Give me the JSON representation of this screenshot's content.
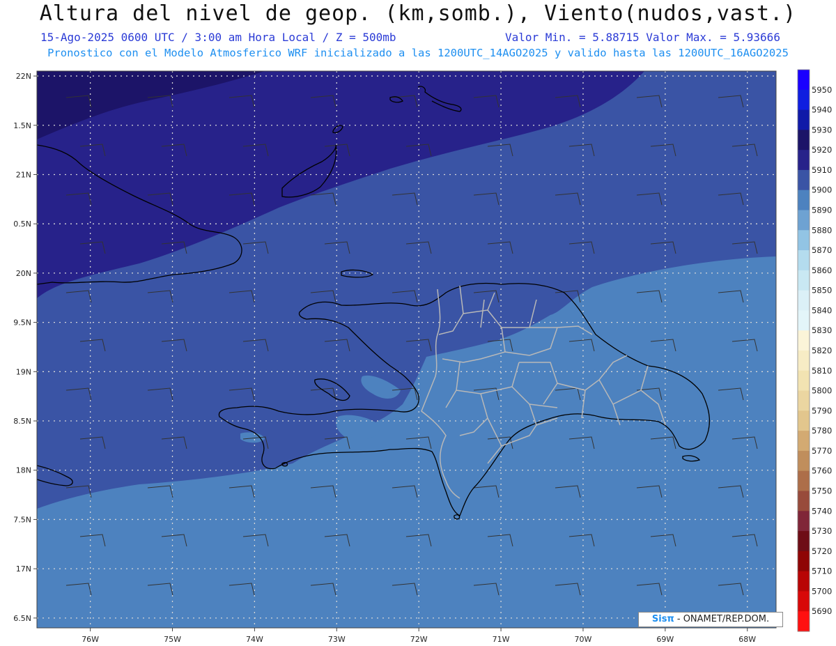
{
  "header": {
    "title": "Altura del nivel de geop. (km,somb.), Viento(nudos,vast.)",
    "line1": "15-Ago-2025  0600 UTC / 3:00 am Hora Local / Z = 500mb",
    "minmax": "Valor Min. = 5.88715  Valor Max. = 5.93666",
    "line2": "Pronostico con el Modelo Atmosferico WRF inicializado a las 1200UTC_14AGO2025 y valido hasta las  1200UTC_16AGO2025"
  },
  "credit": {
    "logo": "Sisπ",
    "text": "- ONAMET/REP.DOM."
  },
  "map": {
    "lon_range": [
      -76.65,
      -67.65
    ],
    "lat_range": [
      16.4,
      22.05
    ],
    "lon_ticks": [
      {
        "value": -76,
        "label": "76W"
      },
      {
        "value": -75,
        "label": "75W"
      },
      {
        "value": -74,
        "label": "74W"
      },
      {
        "value": -73,
        "label": "73W"
      },
      {
        "value": -72,
        "label": "72W"
      },
      {
        "value": -71,
        "label": "71W"
      },
      {
        "value": -70,
        "label": "70W"
      },
      {
        "value": -69,
        "label": "69W"
      },
      {
        "value": -68,
        "label": "68W"
      }
    ],
    "lat_ticks": [
      {
        "value": 22,
        "label": "22N"
      },
      {
        "value": 21.5,
        "label": "1.5N"
      },
      {
        "value": 21,
        "label": "21N"
      },
      {
        "value": 20.5,
        "label": "0.5N"
      },
      {
        "value": 20,
        "label": "20N"
      },
      {
        "value": 19.5,
        "label": "9.5N"
      },
      {
        "value": 19,
        "label": "19N"
      },
      {
        "value": 18.5,
        "label": "8.5N"
      },
      {
        "value": 18,
        "label": "18N"
      },
      {
        "value": 17.5,
        "label": "7.5N"
      },
      {
        "value": 17,
        "label": "17N"
      },
      {
        "value": 16.5,
        "label": "6.5N"
      }
    ],
    "band_colors": {
      "b5920": "#1c1468",
      "b5910": "#27228a",
      "b5900": "#3a54a5",
      "b5890": "#4d82bf"
    }
  },
  "colorbar": {
    "levels": [
      {
        "label": "5950",
        "color": "#1a00ff"
      },
      {
        "label": "5940",
        "color": "#0f1ee0"
      },
      {
        "label": "5930",
        "color": "#101aa8"
      },
      {
        "label": "5920",
        "color": "#1c1468"
      },
      {
        "label": "5910",
        "color": "#27228a"
      },
      {
        "label": "5900",
        "color": "#3a54a5"
      },
      {
        "label": "5890",
        "color": "#4d82bf"
      },
      {
        "label": "5880",
        "color": "#6ea2d2"
      },
      {
        "label": "5870",
        "color": "#92c4e4"
      },
      {
        "label": "5860",
        "color": "#b4dcee"
      },
      {
        "label": "5850",
        "color": "#c9e8f3"
      },
      {
        "label": "5840",
        "color": "#dbf0f7"
      },
      {
        "label": "5830",
        "color": "#e3f5f9"
      },
      {
        "label": "5820",
        "color": "#fbf4d8"
      },
      {
        "label": "5810",
        "color": "#f7ecc5"
      },
      {
        "label": "5800",
        "color": "#f2e3b2"
      },
      {
        "label": "5790",
        "color": "#ebd6a1"
      },
      {
        "label": "5780",
        "color": "#e2c68d"
      },
      {
        "label": "5770",
        "color": "#d3aa72"
      },
      {
        "label": "5760",
        "color": "#c08e5c"
      },
      {
        "label": "5750",
        "color": "#ad6e49"
      },
      {
        "label": "5740",
        "color": "#984b3b"
      },
      {
        "label": "5730",
        "color": "#802638"
      },
      {
        "label": "5720",
        "color": "#6e0d16"
      },
      {
        "label": "5710",
        "color": "#8f0505"
      },
      {
        "label": "5700",
        "color": "#b80505"
      },
      {
        "label": "5690",
        "color": "#d80808"
      },
      {
        "label": "",
        "color": "#ff1010"
      }
    ]
  }
}
